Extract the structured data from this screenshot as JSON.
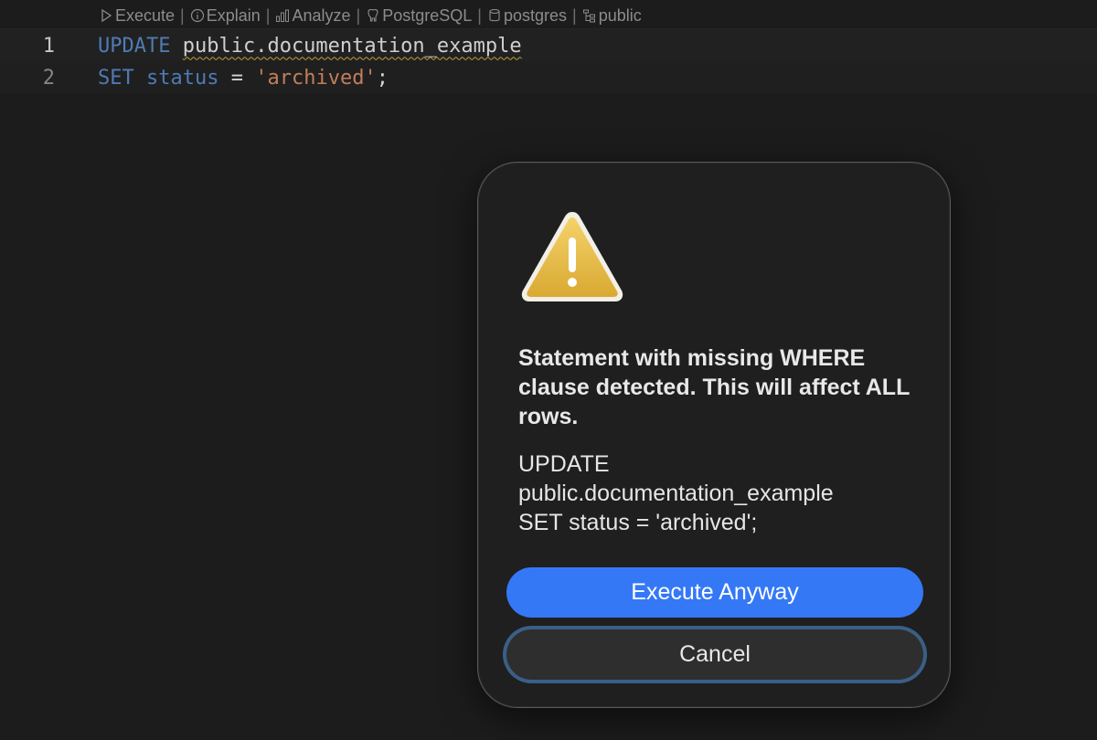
{
  "codelens": {
    "execute": "Execute",
    "explain": "Explain",
    "analyze": "Analyze",
    "engine": "PostgreSQL",
    "database": "postgres",
    "schema": "public",
    "separator": "|"
  },
  "editor": {
    "lines": [
      {
        "number": "1",
        "keyword": "UPDATE",
        "identifier": "public.documentation_example"
      },
      {
        "number": "2",
        "keyword": "SET",
        "column": "status",
        "operator": "=",
        "value": "'archived'",
        "terminator": ";"
      }
    ]
  },
  "dialog": {
    "icon": "warning-triangle-icon",
    "title": "Statement with missing WHERE clause detected. This will affect ALL rows.",
    "body": "UPDATE\npublic.documentation_example\nSET status = 'archived';",
    "primary_label": "Execute Anyway",
    "secondary_label": "Cancel"
  },
  "colors": {
    "accent": "#3478f6",
    "warning": "#e5b93a",
    "focus_ring": "#3a5f87"
  }
}
